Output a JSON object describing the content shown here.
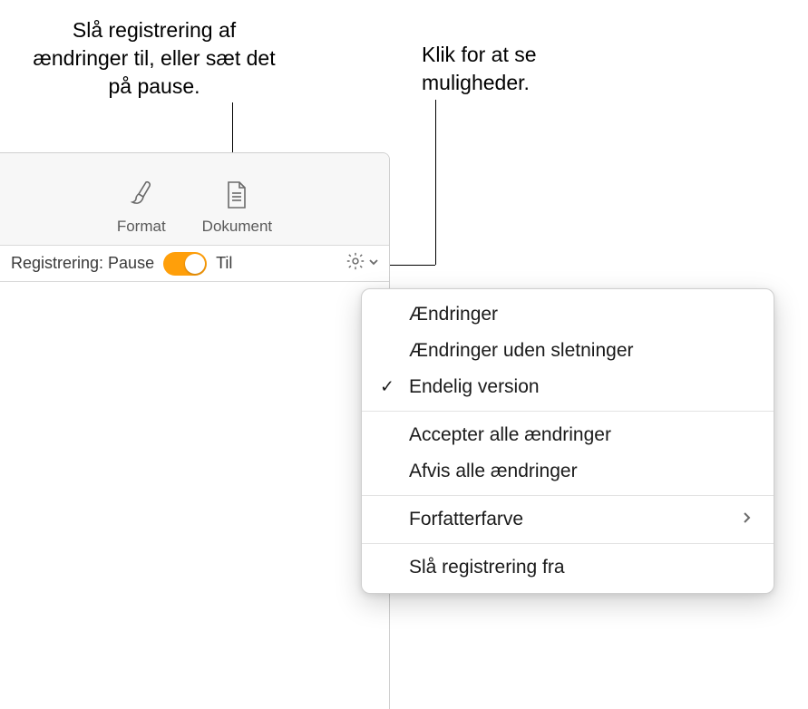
{
  "callouts": {
    "left": "Slå registrering af ændringer til, eller sæt det på pause.",
    "right": "Klik for at se muligheder."
  },
  "toolbar": {
    "format_label": "Format",
    "document_label": "Dokument"
  },
  "tracking": {
    "status_label": "Registrering: Pause",
    "on_label": "Til"
  },
  "menu": {
    "item1": "Ændringer",
    "item2": "Ændringer uden sletninger",
    "item3": "Endelig version",
    "item4": "Accepter alle ændringer",
    "item5": "Afvis alle ændringer",
    "item6": "Forfatterfarve",
    "item7": "Slå registrering fra"
  },
  "icons": {
    "format": "brush-icon",
    "document": "document-icon",
    "gear": "gear-icon",
    "chevron_down": "chevron-down-icon",
    "check": "checkmark-icon",
    "chevron_right": "chevron-right-icon"
  },
  "colors": {
    "toggle_on": "#ff9f0a"
  }
}
